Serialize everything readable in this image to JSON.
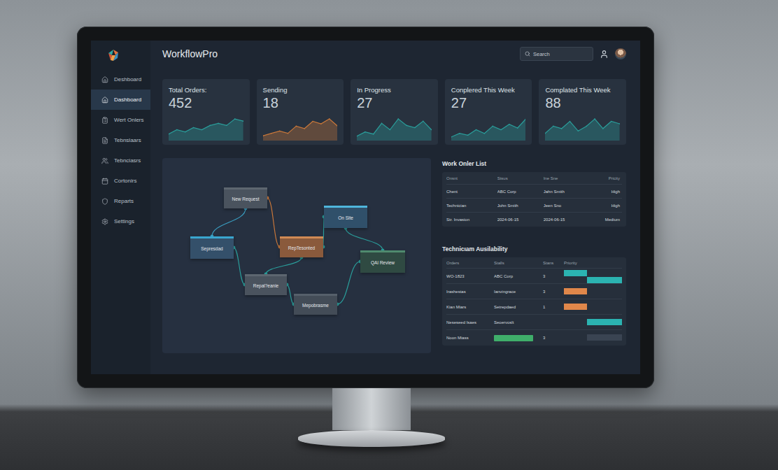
{
  "app": {
    "title": "WorkflowPro"
  },
  "search": {
    "placeholder": "Search"
  },
  "sidebar": {
    "items": [
      {
        "label": "Deshboard",
        "selected": false
      },
      {
        "label": "Dashboard",
        "selected": true
      },
      {
        "label": "Wert Onlers",
        "selected": false
      },
      {
        "label": "Tebnslaars",
        "selected": false
      },
      {
        "label": "Tebnciasrs",
        "selected": false
      },
      {
        "label": "Cortonirs",
        "selected": false
      },
      {
        "label": "Reparts",
        "selected": false
      },
      {
        "label": "Settings",
        "selected": false
      }
    ]
  },
  "stats": [
    {
      "label": "Total Orders:",
      "value": "452",
      "color": "#2a9d9a",
      "values": [
        3,
        5,
        4,
        6,
        5,
        7,
        8,
        7,
        10,
        9
      ]
    },
    {
      "label": "Sending",
      "value": "18",
      "color": "#c8773a",
      "values": [
        2,
        3,
        4,
        3,
        6,
        5,
        8,
        7,
        9,
        6
      ]
    },
    {
      "label": "In Progress",
      "value": "27",
      "color": "#2a9d9a",
      "values": [
        2,
        4,
        3,
        8,
        5,
        10,
        7,
        6,
        9,
        5
      ]
    },
    {
      "label": "Conplered This Week",
      "value": "27",
      "color": "#2a9d9a",
      "values": [
        2,
        4,
        3,
        6,
        4,
        8,
        6,
        9,
        7,
        12
      ]
    },
    {
      "label": "Complated This Week",
      "value": "88",
      "color": "#2a9d9a",
      "values": [
        3,
        6,
        5,
        8,
        4,
        6,
        9,
        5,
        8,
        7
      ]
    }
  ],
  "diagram": {
    "nodes": [
      {
        "label": "New Request",
        "color": "#4a535e",
        "accent": "#5d6670"
      },
      {
        "label": "Sepresdad",
        "color": "#34506a",
        "accent": "#3aa6cf"
      },
      {
        "label": "RepTesonted",
        "color": "#8a5a3c",
        "accent": "#d08a55"
      },
      {
        "label": "On Site",
        "color": "#30506a",
        "accent": "#4fb6dc"
      },
      {
        "label": "QAl Review",
        "color": "#2f4a42",
        "accent": "#4f8a6e"
      },
      {
        "label": "Repal?eanie",
        "color": "#4a535e",
        "accent": "#5d6670"
      },
      {
        "label": "Mepobrasme",
        "color": "#434c57",
        "accent": "#56606b"
      }
    ],
    "edges": [
      {
        "from": 0,
        "to": 1,
        "color": "#3a9fc2"
      },
      {
        "from": 0,
        "to": 2,
        "color": "#c8773a"
      },
      {
        "from": 2,
        "to": 3,
        "color": "#2a9d9a"
      },
      {
        "from": 3,
        "to": 4,
        "color": "#2a9d9a"
      },
      {
        "from": 1,
        "to": 5,
        "color": "#2a9d9a"
      },
      {
        "from": 2,
        "to": 5,
        "color": "#2a9d9a"
      },
      {
        "from": 5,
        "to": 6,
        "color": "#2a9d9a"
      },
      {
        "from": 4,
        "to": 6,
        "color": "#2a9d9a"
      }
    ]
  },
  "work_orders": {
    "title": "Work Onler List",
    "columns": [
      "Onsnt",
      "Stsus",
      "Ine Sne",
      "Pricity"
    ],
    "rows": [
      [
        "Chent",
        "ABC Corp",
        "Jahn Smith",
        "High"
      ],
      [
        "Technician",
        "John Smith",
        "Jeen Sno",
        "High"
      ],
      [
        "Str. Invasion",
        "2024-06-15",
        "2024-06-15",
        "Medium"
      ]
    ]
  },
  "technicians": {
    "title": "Technicıam Ausilability",
    "columns": [
      "Orders",
      "Stalls",
      "Stans",
      "Priority"
    ],
    "rows": [
      {
        "name": "WO-1823",
        "kind": "text",
        "status": "ABC Corp",
        "status_color": "",
        "count": "3",
        "bars": [
          {
            "start": 0,
            "end": 0.4,
            "lane": 0,
            "color": "#2bb3b1"
          },
          {
            "start": 0.4,
            "end": 1,
            "lane": 1,
            "color": "#2bb3b1"
          }
        ]
      },
      {
        "name": "Irashestas",
        "kind": "text",
        "status": "Ianvingrace",
        "status_color": "",
        "count": "3",
        "bars": [
          {
            "start": 0,
            "end": 0.4,
            "lane": 0,
            "color": "#e0874a"
          }
        ]
      },
      {
        "name": "Kian Miars",
        "kind": "text",
        "status": "Setrepdaed",
        "status_color": "",
        "count": "1",
        "bars": [
          {
            "start": 0,
            "end": 0.4,
            "lane": 0,
            "color": "#e0874a"
          }
        ]
      },
      {
        "name": "Neseseed Isaes",
        "kind": "text",
        "status": "Seoervoslt",
        "status_color": "",
        "count": "",
        "bars": [
          {
            "start": 0.4,
            "end": 1,
            "lane": 0,
            "color": "#2bb3b1"
          }
        ]
      },
      {
        "name": "Noon Miass",
        "kind": "bar",
        "status": "",
        "status_color": "#3fae6a",
        "count": "3",
        "bars": [
          {
            "start": 0.4,
            "end": 1,
            "lane": 0,
            "color": "#3a4452"
          }
        ]
      }
    ]
  }
}
